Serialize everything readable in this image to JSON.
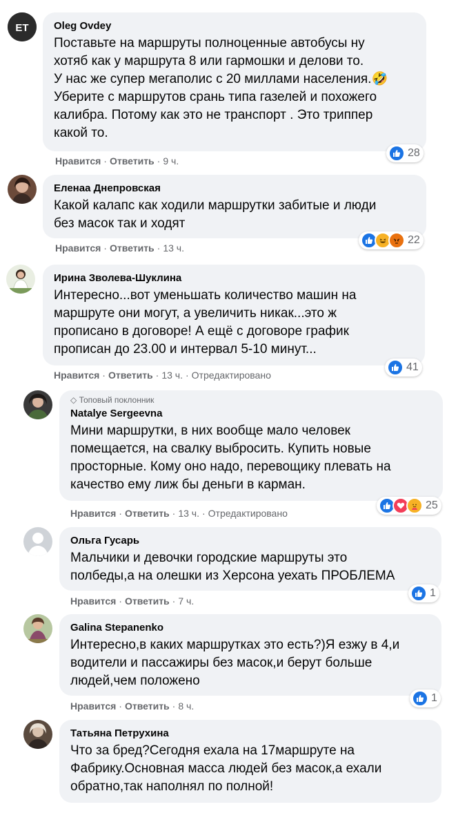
{
  "actions": {
    "like": "Нравится",
    "reply": "Ответить",
    "edited": "Отредактировано"
  },
  "comments": [
    {
      "author": "Oleg Ovdey",
      "text": "Поставьте на маршруты полноценные автобусы ну\nхотяб как у маршрута 8 или гармошки и делови то.\nУ нас же супер мегаполис с 20 миллами населения.🤣\nУберите с маршрутов срань типа газелей и похожего\nкалибра. Потому как это не транспорт . Это триппер\nкакой то.",
      "time": "9 ч.",
      "reactions": [
        "like"
      ],
      "reaction_count": "28",
      "avatar_text": "ЕТ",
      "colors": {
        "avatar": "#2b2b2b"
      }
    },
    {
      "author": "Еленаа Днепровская",
      "text": "Какой калапс как ходили маршрутки забитые и люди\nбез масок так и ходят",
      "time": "13 ч.",
      "reactions": [
        "like",
        "haha",
        "angry"
      ],
      "reaction_count": "22",
      "colors": {
        "avatar": "#6b4a3a"
      }
    },
    {
      "author": "Ирина Зволева-Шуклина",
      "text": "Интересно...вот уменьшать количество машин на\nмаршруте они могут, а увеличить никак...это ж\nпрописано в договоре! А ещё с договоре график\nпрописан до 23.00 и интервал 5-10 минут...",
      "time": "13 ч.",
      "edited": true,
      "reactions": [
        "like"
      ],
      "reaction_count": "41",
      "colors": {
        "avatar": "#7a9a5a"
      }
    },
    {
      "author": "Natalye Sergeevna",
      "badge": "Топовый поклонник",
      "text": "Мини маршрутки, в них вообще мало человек\nпомещается, на свалку выбросить. Купить новые\nпросторные. Кому оно надо, перевощику плевать на\nкачество ему лиж бы деньги в карман.",
      "time": "13 ч.",
      "edited": true,
      "reactions": [
        "like",
        "love",
        "care"
      ],
      "reaction_count": "25",
      "colors": {
        "avatar": "#3a3a3a"
      }
    },
    {
      "author": "Ольга Гусарь",
      "text": "Мальчики и девочки городские маршруты это\nполбеды,а на олешки из Херсона уехать ПРОБЛЕМА",
      "time": "7 ч.",
      "reactions": [
        "like"
      ],
      "reaction_count": "1",
      "colors": {
        "avatar": "#cfd3d8"
      }
    },
    {
      "author": "Galina Stepanenko",
      "text": "Интересно,в каких маршрутках это есть?)Я езжу в 4,и\nводители и пассажиры без масок,и берут больше\nлюдей,чем положено",
      "time": "8 ч.",
      "reactions": [
        "like"
      ],
      "reaction_count": "1",
      "colors": {
        "avatar": "#8a7a4a"
      }
    },
    {
      "author": "Татьяна Петрухина",
      "text": "Что за бред?Сегодня ехала на 17маршруте на\nФабрику.Основная масса людей без масок,а ехали\nобратно,так наполнял по полной!",
      "colors": {
        "avatar": "#5a4a3e"
      }
    }
  ]
}
